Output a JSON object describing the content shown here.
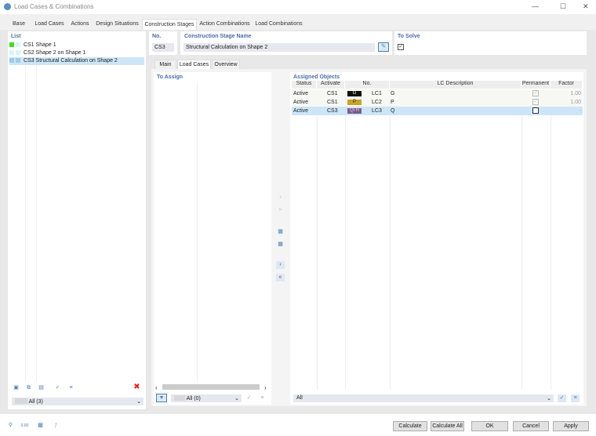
{
  "window": {
    "title": "Load Cases & Combinations"
  },
  "tabs": [
    {
      "label": "Base"
    },
    {
      "label": "Load Cases"
    },
    {
      "label": "Actions"
    },
    {
      "label": "Design Situations"
    },
    {
      "label": "Construction Stages"
    },
    {
      "label": "Action Combinations"
    },
    {
      "label": "Load Combinations"
    }
  ],
  "list": {
    "header": "List",
    "items": [
      {
        "id": "CS1",
        "name": "Shape 1",
        "color": "#44dd22"
      },
      {
        "id": "CS2",
        "name": "Shape 2 on Shape 1",
        "color": "#d8f4fb"
      },
      {
        "id": "CS3",
        "name": "Structural Calculation on Shape 2",
        "color": "#9ccde6"
      }
    ],
    "filter": "All (3)"
  },
  "no": {
    "label": "No.",
    "value": "CS3"
  },
  "name": {
    "label": "Construction Stage Name",
    "value": "Structural Calculation on Shape 2"
  },
  "to_solve": {
    "label": "To Solve",
    "checked": true
  },
  "subtabs": [
    {
      "label": "Main"
    },
    {
      "label": "Load Cases"
    },
    {
      "label": "Overview"
    }
  ],
  "to_assign": {
    "header": "To Assign",
    "filter": "All (0)"
  },
  "assigned": {
    "header": "Assigned Objects",
    "columns": [
      "Status",
      "Activate",
      "No.",
      "LC Description",
      "Permanent",
      "Factor"
    ],
    "rows": [
      {
        "status": "Active",
        "activate": "CS1",
        "badge": "G",
        "badge_color": "#111111",
        "lc": "LC1",
        "desc": "G",
        "permanent": true,
        "factor": "1.00"
      },
      {
        "status": "Active",
        "activate": "CS1",
        "badge": "P",
        "badge_color": "#c9a227",
        "lc": "LC2",
        "desc": "P",
        "permanent": true,
        "factor": "1.00"
      },
      {
        "status": "Active",
        "activate": "CS3",
        "badge": "Qi H",
        "badge_color": "#7b5b8f",
        "lc": "LC3",
        "desc": "Q",
        "permanent": false,
        "factor": "-"
      }
    ],
    "filter": "All"
  },
  "footer": {
    "calculate": "Calculate",
    "calculate_all": "Calculate All",
    "ok": "OK",
    "cancel": "Cancel",
    "apply": "Apply"
  }
}
